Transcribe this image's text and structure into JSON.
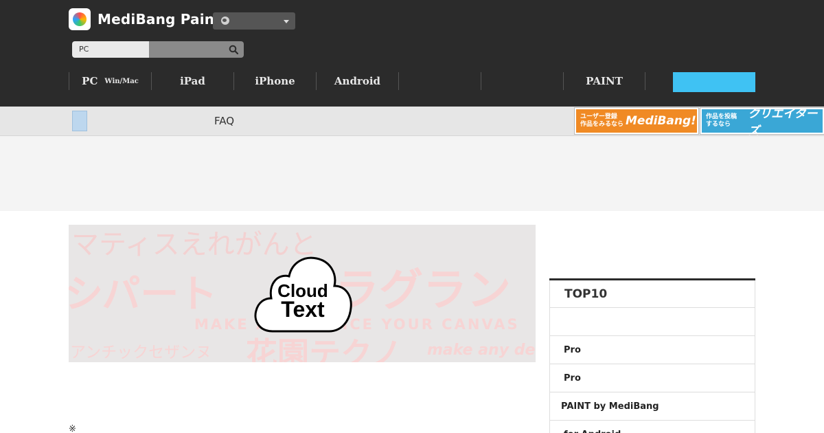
{
  "header": {
    "logo_text": "MediBang Paint",
    "search": {
      "value": "PC"
    },
    "nav": [
      {
        "label": "PC",
        "sub": "Win/Mac"
      },
      {
        "label": "iPad",
        "sub": ""
      },
      {
        "label": "iPhone",
        "sub": ""
      },
      {
        "label": "Android",
        "sub": ""
      },
      {
        "label": "",
        "sub": ""
      },
      {
        "label": "",
        "sub": ""
      },
      {
        "label": "PAINT",
        "sub": ""
      },
      {
        "label": "",
        "sub": ""
      }
    ]
  },
  "subbar": {
    "faq_label": "FAQ",
    "banner_medibang": {
      "small": "ユーザー登録\n作品をみるなら",
      "big": "MediBang!"
    },
    "banner_creators": {
      "small": "作品を投稿\nするなら",
      "big": "クリエイターズ"
    }
  },
  "hero": {
    "row1": "マティスえれがんと",
    "row2_left": "シパート",
    "row2_right": "ラグラン",
    "row3": "MAKE ANY DEVICE YOUR CANVAS",
    "row4_left": "アンチックセザンヌ",
    "row4_mid": "花園テクノ",
    "row4_right": "make any device",
    "cloud_line1": "Cloud",
    "cloud_line2": "Text"
  },
  "note": "※",
  "sidebar": {
    "title": "TOP10",
    "rows": [
      "",
      "Pro",
      "Pro",
      "PAINT by MediBang",
      "for Android"
    ]
  },
  "colors": {
    "header_bg": "#2b2b2b",
    "accent_cyan": "#3fc2f3",
    "banner_orange": "#f08a24",
    "banner_blue": "#3aa7d6"
  }
}
